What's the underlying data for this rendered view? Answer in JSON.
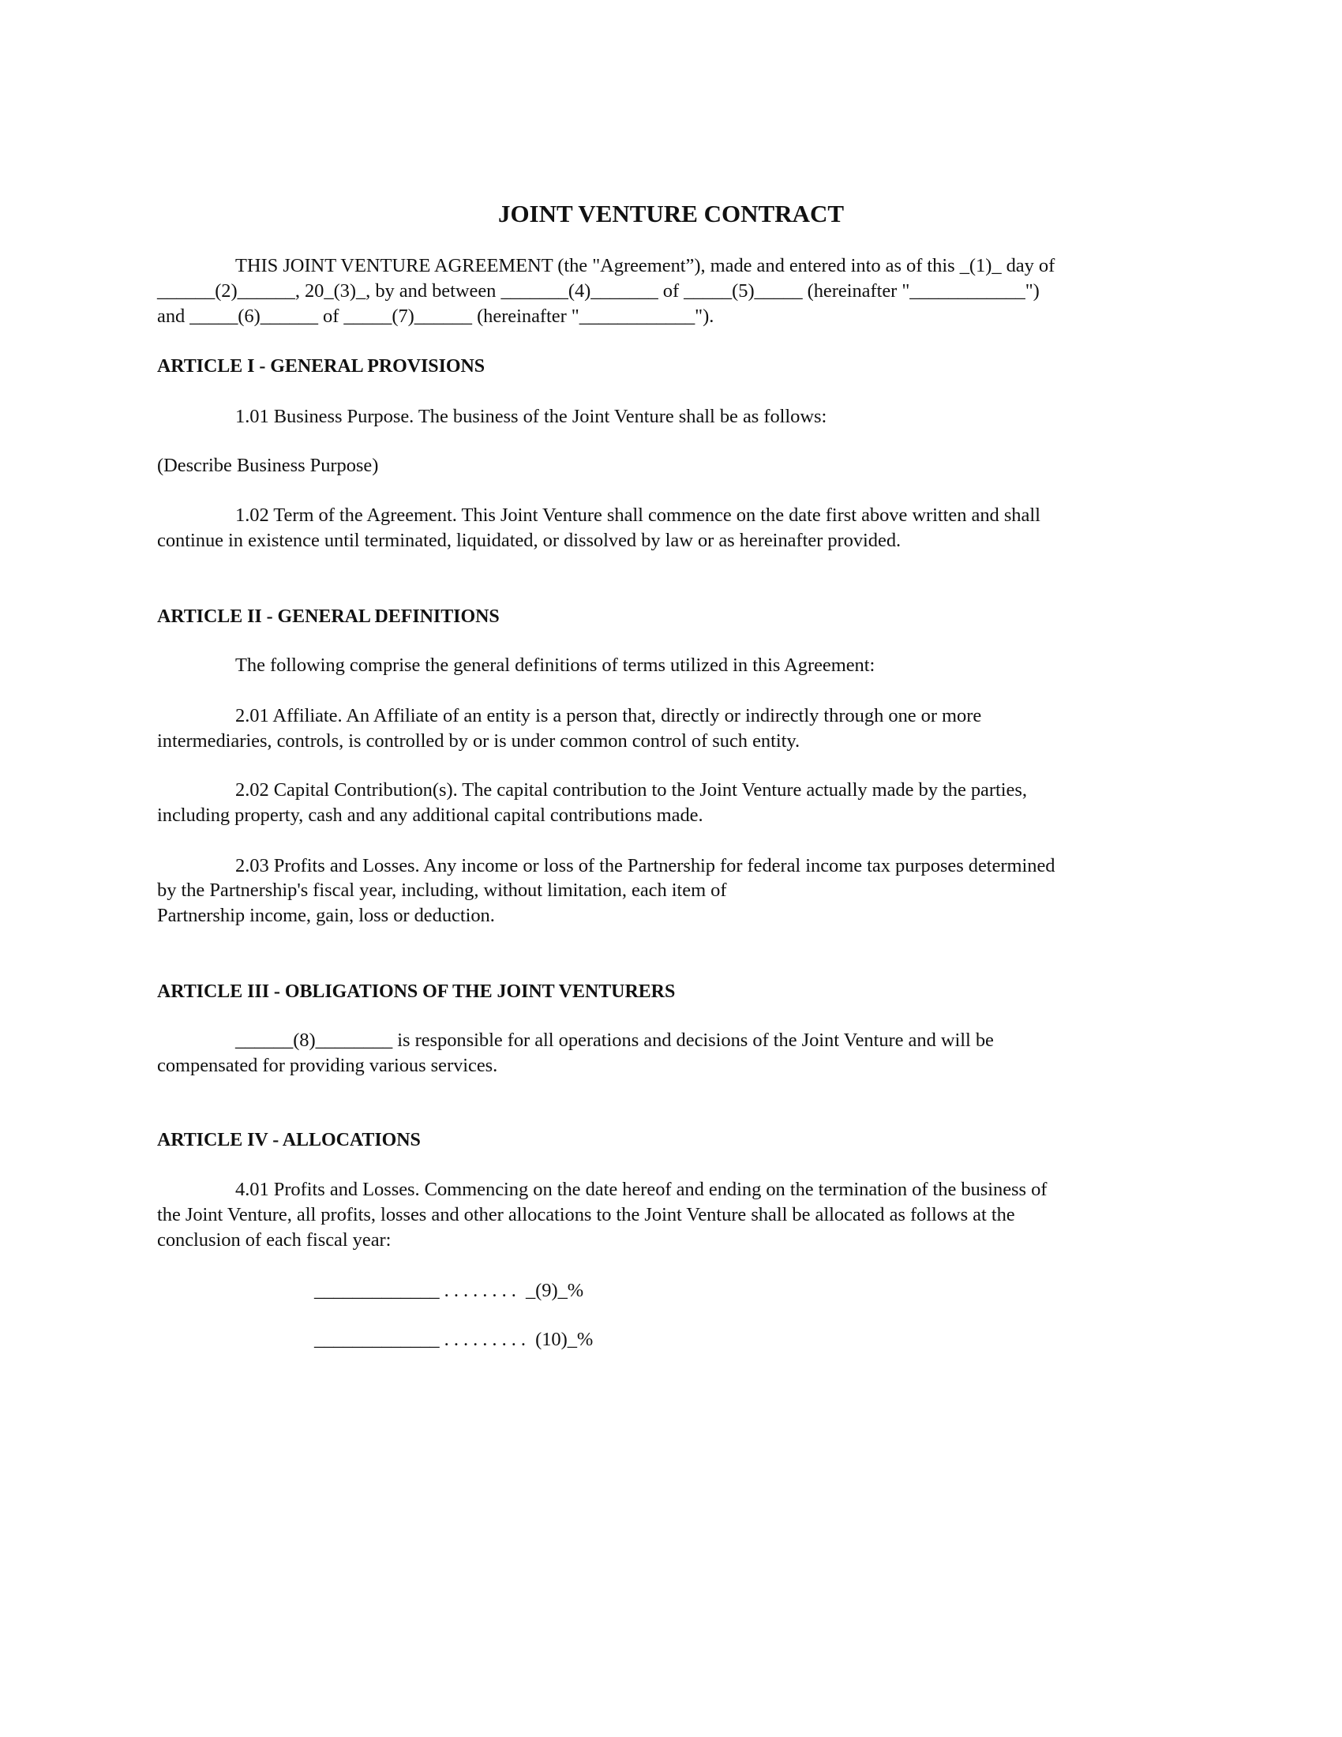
{
  "document": {
    "title": "JOINT VENTURE CONTRACT",
    "preamble": [
      "THIS JOINT VENTURE AGREEMENT (the \"Agreement”), made and entered into as of this _(1)_ day of",
      "______(2)______, 20_(3)_, by and between _______(4)_______ of _____(5)_____ (hereinafter \"____________\")",
      "and _____(6)______ of _____(7)______ (hereinafter \"____________\")."
    ],
    "articles": [
      {
        "heading": "ARTICLE I - GENERAL PROVISIONS",
        "sections": [
          {
            "lines": [
              "1.01 Business Purpose. The business of the Joint Venture shall be as follows:"
            ]
          },
          {
            "lines": [
              "(Describe Business Purpose)"
            ]
          },
          {
            "lines": [
              "1.02 Term of the Agreement. This Joint Venture shall commence on the date first above written and shall",
              "continue in existence until terminated, liquidated, or dissolved by law or as hereinafter provided."
            ]
          }
        ]
      },
      {
        "heading": "ARTICLE II - GENERAL DEFINITIONS",
        "sections": [
          {
            "lines": [
              "The following comprise the general definitions of terms utilized in this Agreement:"
            ]
          },
          {
            "lines": [
              "2.01 Affiliate. An Affiliate of an entity is a person that, directly or indirectly through one or more",
              "intermediaries, controls, is controlled by or is under common control of such entity."
            ]
          },
          {
            "lines": [
              "2.02 Capital Contribution(s). The capital contribution to the Joint Venture actually made by the parties,",
              "including property, cash and any additional capital contributions made."
            ]
          },
          {
            "lines": [
              "2.03 Profits and Losses. Any income or loss of the Partnership for federal income tax purposes determined",
              "by the Partnership's fiscal year, including, without limitation, each item of",
              "Partnership income, gain, loss or deduction."
            ]
          }
        ]
      },
      {
        "heading": "ARTICLE III - OBLIGATIONS OF THE JOINT VENTURERS",
        "sections": [
          {
            "lines": [
              "______(8)________ is responsible for all operations and decisions of the Joint Venture and will be",
              "compensated for providing various services."
            ]
          }
        ]
      },
      {
        "heading": "ARTICLE IV - ALLOCATIONS",
        "sections": [
          {
            "lines": [
              "4.01 Profits and Losses. Commencing on the date hereof and ending on the termination of the business of",
              "the Joint Venture, all profits, losses and other allocations to the Joint Venture shall be allocated as follows at the",
              "conclusion of each fiscal year:"
            ]
          }
        ]
      }
    ],
    "allocations": [
      "_____________ . . . . . . . .  _(9)_%",
      "_____________ . . . . . . . . .  (10)_%"
    ]
  }
}
